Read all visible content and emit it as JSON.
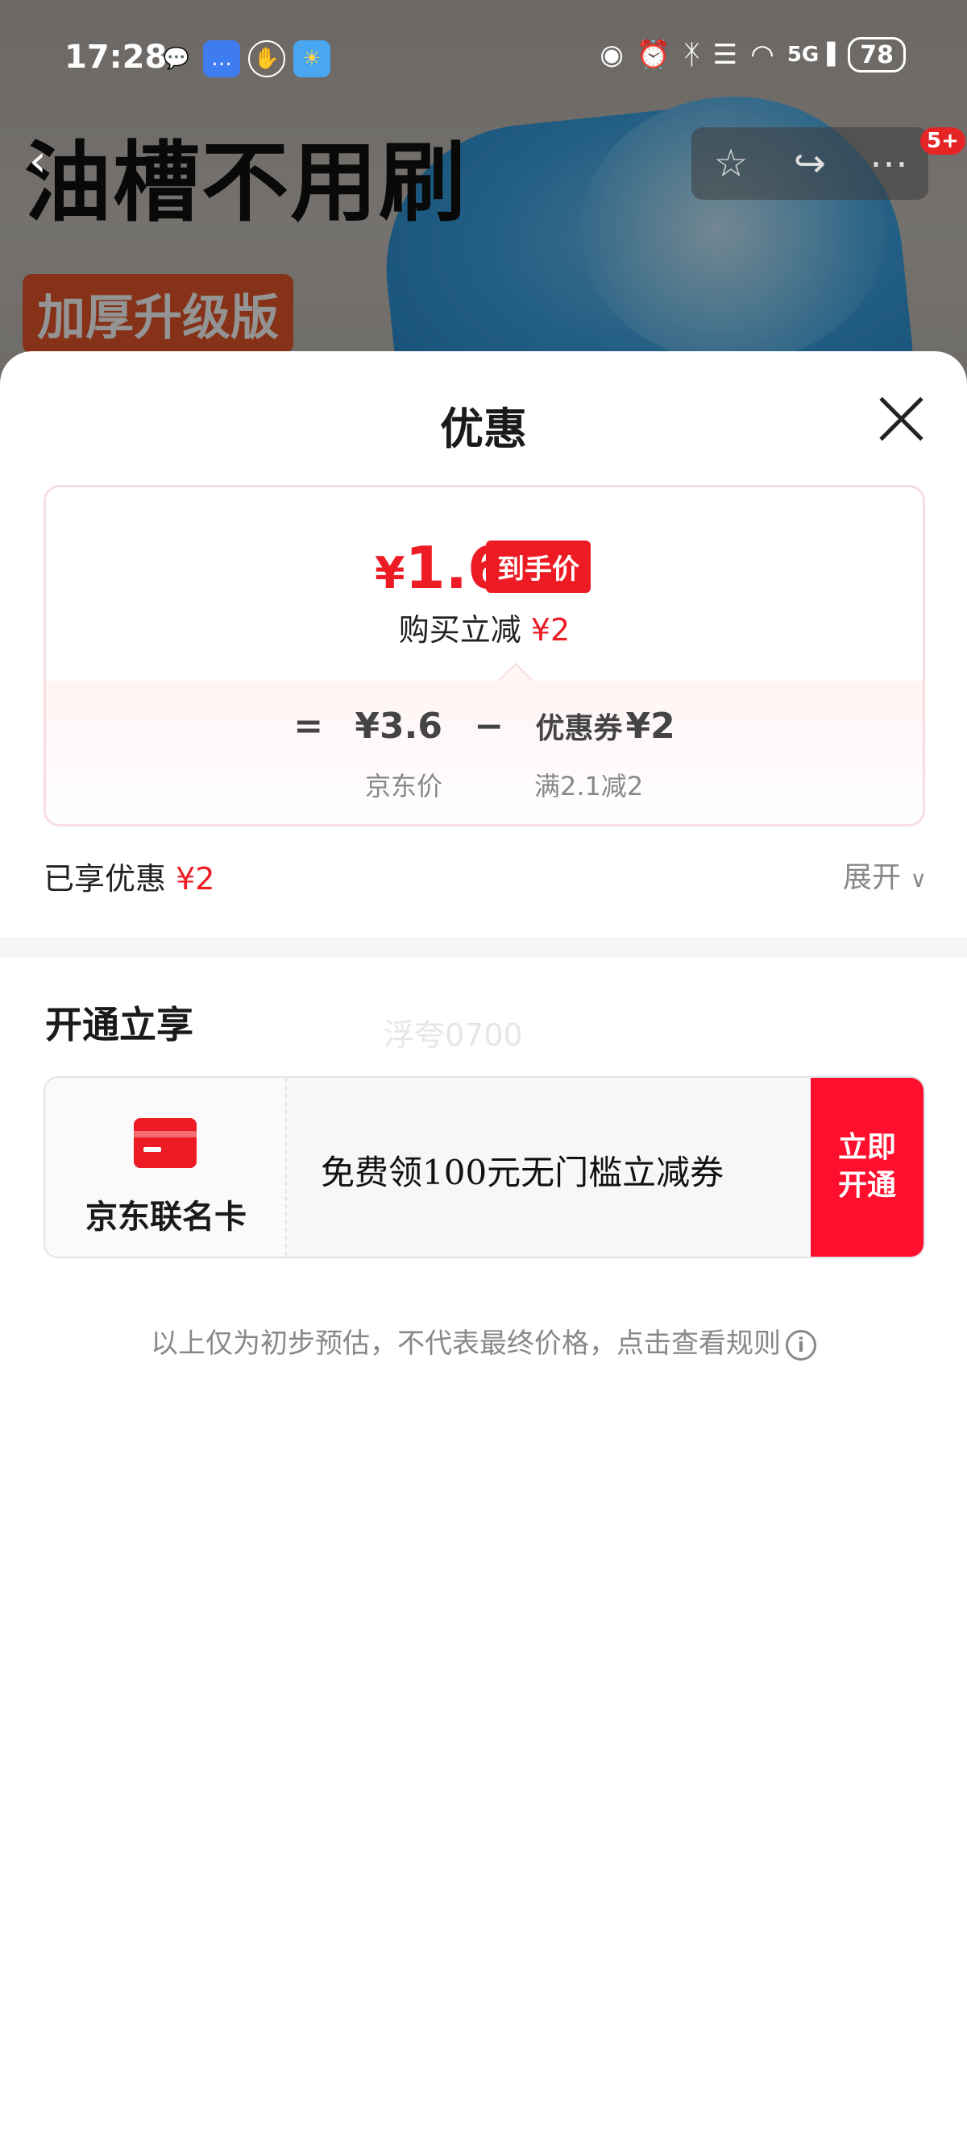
{
  "status_bar": {
    "time": "17:28",
    "network": "5G",
    "battery": "78"
  },
  "background": {
    "headline": "油槽不用刷",
    "tag": "加厚升级版",
    "cart_badge": "5+"
  },
  "sheet": {
    "title": "优惠",
    "price": {
      "currency": "¥",
      "final_value": "1.6",
      "final_tag": "到手价",
      "reduce_label": "购买立减",
      "reduce_value": "¥2",
      "formula": {
        "equals": "=",
        "jd_price": "¥3.6",
        "minus": "−",
        "coupon_label": "优惠券",
        "coupon_value": "¥2",
        "jd_price_label": "京东价",
        "coupon_condition": "满2.1减2"
      }
    },
    "enjoyed": {
      "label": "已享优惠",
      "value": "¥2",
      "expand_label": "展开"
    },
    "membership": {
      "section_title": "开通立享",
      "watermark": "浮夸0700",
      "card_name": "京东联名卡",
      "description": "免费领100元无门槛立减券",
      "button_line1": "立即",
      "button_line2": "开通"
    },
    "disclaimer": "以上仅为初步预估，不代表最终价格，点击查看规则"
  },
  "colors": {
    "accent_red": "#ed1c24",
    "button_red": "#ff0f2e",
    "muted_text": "#888888"
  }
}
